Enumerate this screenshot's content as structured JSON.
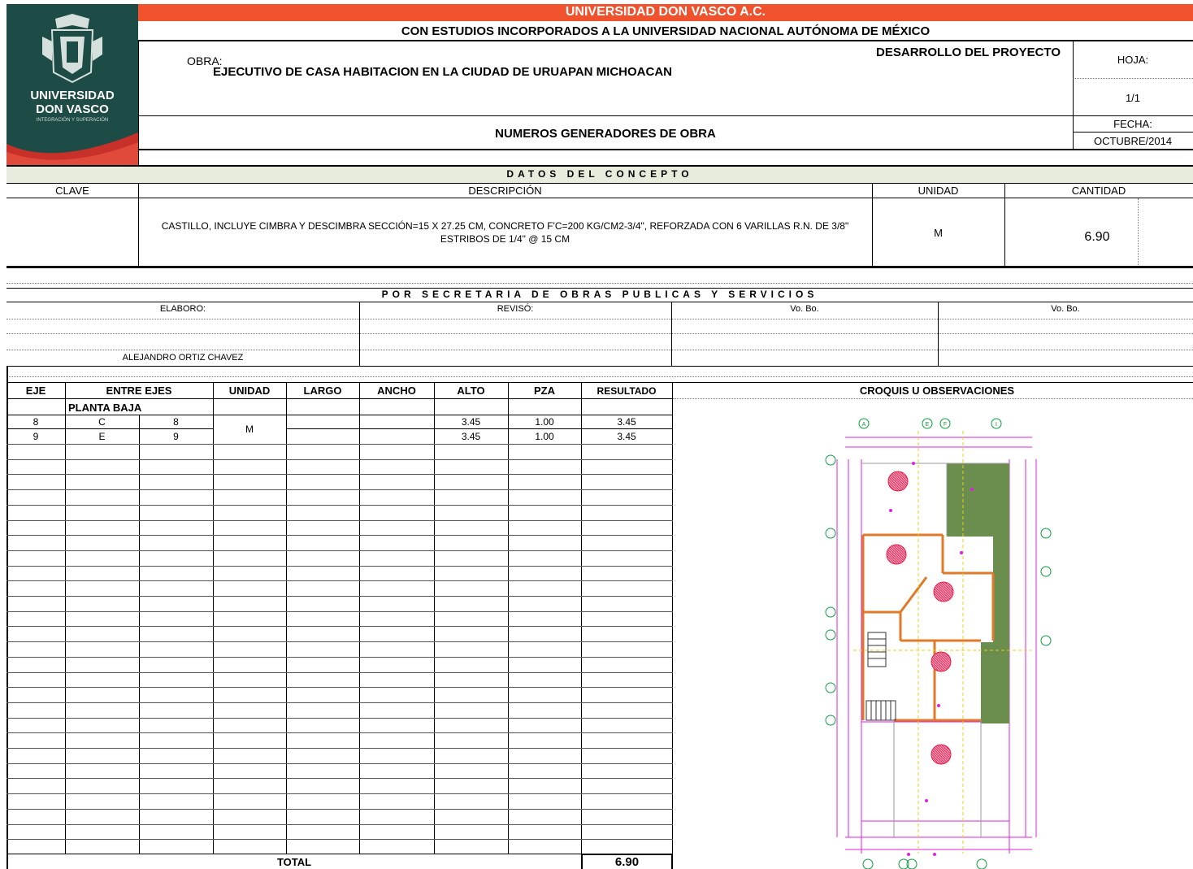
{
  "header": {
    "university_title": "UNIVERSIDAD DON VASCO A.C.",
    "incorporation": "CON ESTUDIOS INCORPORADOS A LA UNIVERSIDAD NACIONAL AUTÓNOMA DE MÉXICO",
    "obra_label": "OBRA:",
    "obra_value": "EJECUTIVO DE CASA HABITACION EN LA CIUDAD DE URUAPAN MICHOACAN",
    "project_stage": "DESARROLLO DEL PROYECTO",
    "document_title": "NUMEROS GENERADORES DE OBRA",
    "hoja_label": "HOJA:",
    "hoja_value": "1/1",
    "fecha_label": "FECHA:",
    "fecha_value": "OCTUBRE/2014",
    "accent_color": "#f0522e"
  },
  "logo": {
    "line1": "UNIVERSIDAD",
    "line2": "DON VASCO",
    "tagline": "INTEGRACIÓN Y SUPERACIÓN",
    "bg_color": "#1d4b45"
  },
  "concepto": {
    "section_title": "DATOS DEL CONCEPTO",
    "headers": {
      "clave": "CLAVE",
      "descripcion": "DESCRIPCIÓN",
      "unidad": "UNIDAD",
      "cantidad": "CANTIDAD"
    },
    "clave": "",
    "descripcion": "CASTILLO, INCLUYE CIMBRA Y DESCIMBRA SECCIÓN=15 X 27.25 CM, CONCRETO F'C=200 KG/CM2-3/4\", REFORZADA CON 6 VARILLAS R.N. DE 3/8\" ESTRIBOS DE 1/4\" @ 15 CM",
    "unidad": "M",
    "cantidad": "6.90"
  },
  "secretaria": {
    "section_title": "POR SECRETARIA DE OBRAS PUBLICAS Y SERVICIOS",
    "elaboro_label": "ELABORO:",
    "reviso_label": "REVISÓ:",
    "vobo1_label": "Vo. Bo.",
    "vobo2_label": "Vo. Bo.",
    "elaboro_name": "ALEJANDRO ORTIZ CHAVEZ"
  },
  "table": {
    "headers": [
      "EJE",
      "ENTRE EJES",
      "UNIDAD",
      "LARGO",
      "ANCHO",
      "ALTO",
      "PZA",
      "RESULTADO"
    ],
    "section": "PLANTA BAJA",
    "unit": "M",
    "rows": [
      {
        "eje": "8",
        "de": "C",
        "a": "8",
        "alto": "3.45",
        "pza": "1.00",
        "resultado": "3.45"
      },
      {
        "eje": "9",
        "de": "E",
        "a": "9",
        "alto": "3.45",
        "pza": "1.00",
        "resultado": "3.45"
      }
    ],
    "total_label": "TOTAL",
    "total_value": "6.90"
  },
  "croquis": {
    "title": "CROQUIS U OBSERVACIONES",
    "axis_labels": [
      "A",
      "E",
      "F",
      "I"
    ]
  }
}
